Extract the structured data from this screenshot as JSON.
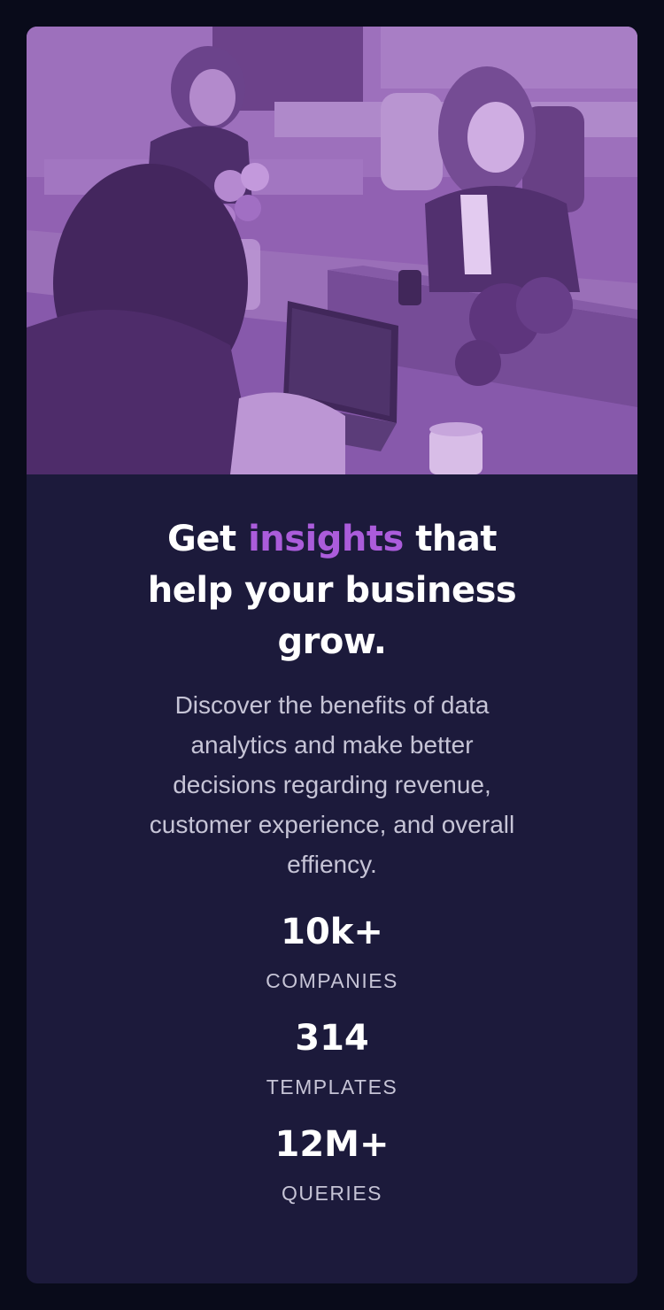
{
  "hero": {
    "image_name": "office-team-photo",
    "tint_color": "#aa5cdb"
  },
  "headline": {
    "part1": "Get ",
    "accent": "insights",
    "part2": " that help your business grow."
  },
  "description": "Discover the benefits of data analytics and make better decisions regarding revenue, customer experience, and overall effiency.",
  "stats": [
    {
      "value": "10k+",
      "label": "COMPANIES"
    },
    {
      "value": "314",
      "label": "TEMPLATES"
    },
    {
      "value": "12M+",
      "label": "QUERIES"
    }
  ],
  "colors": {
    "page_background": "#090b1a",
    "card_background": "#1c1a3b",
    "accent": "#ab5cdb",
    "heading_text": "#ffffff",
    "body_text": "#c6c4d6"
  }
}
